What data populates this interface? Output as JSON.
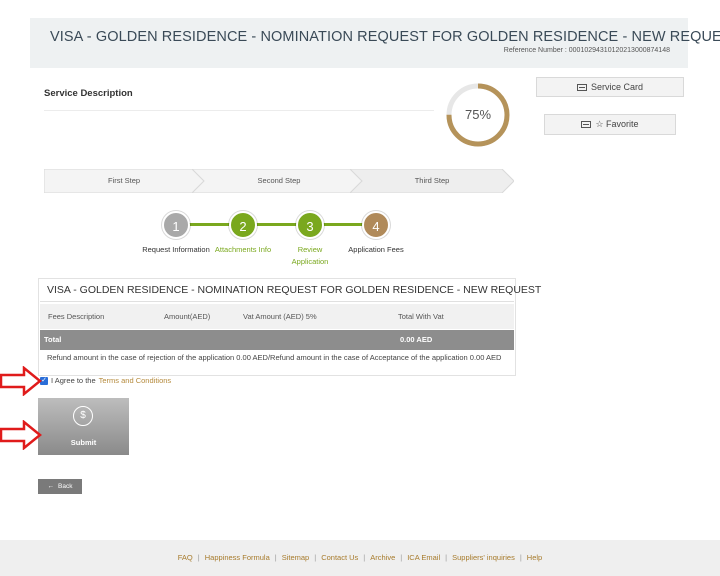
{
  "header": {
    "title": "VISA - GOLDEN RESIDENCE - NOMINATION REQUEST FOR GOLDEN RESIDENCE - NEW REQUEST",
    "reference": "Reference Number : 00010294310120213000874148"
  },
  "service": {
    "title": "Service Description",
    "progress_label": "75%",
    "progress": 0.75
  },
  "actions": {
    "service_card": "Service Card",
    "favorite": "☆ Favorite"
  },
  "stepbar": {
    "steps": [
      "First Step",
      "Second Step",
      "Third Step"
    ]
  },
  "steps": [
    {
      "number": "1",
      "label": "Request Information",
      "color": "#a9a9a9",
      "label_color": "#333333"
    },
    {
      "number": "2",
      "label": "Attachments Info",
      "color": "#7aa81e",
      "label_color": "#7aa81e"
    },
    {
      "number": "3",
      "label": "Review Application",
      "color": "#7aa81e",
      "label_color": "#7aa81e"
    },
    {
      "number": "4",
      "label": "Application Fees",
      "color": "#b08a5a",
      "label_color": "#333333"
    }
  ],
  "fees": {
    "title": "VISA - GOLDEN RESIDENCE - NOMINATION REQUEST FOR GOLDEN RESIDENCE - NEW REQUEST",
    "columns": [
      "Fees Description",
      "Amount(AED)",
      "Vat Amount (AED) 5%",
      "Total With Vat"
    ],
    "total_label": "Total",
    "total_value": "0.00 AED",
    "refund_note": "Refund amount in the case of rejection of the application 0.00 AED/Refund amount in the case of Acceptance of the application 0.00 AED"
  },
  "agree": {
    "text": "I Agree to the",
    "link": "Terms and Conditions",
    "checked": true
  },
  "submit": {
    "icon": "dollar-refresh-icon",
    "label": "Submit"
  },
  "back": {
    "label": "Back"
  },
  "footer": {
    "links": [
      "FAQ",
      "Happiness Formula",
      "Sitemap",
      "Contact Us",
      "Archive",
      "ICA Email",
      "Suppliers' inquiries",
      "Help"
    ]
  },
  "colors": {
    "accent_green": "#7aa81e",
    "accent_gold": "#b58a3c",
    "arrow_red": "#e01b1b"
  }
}
